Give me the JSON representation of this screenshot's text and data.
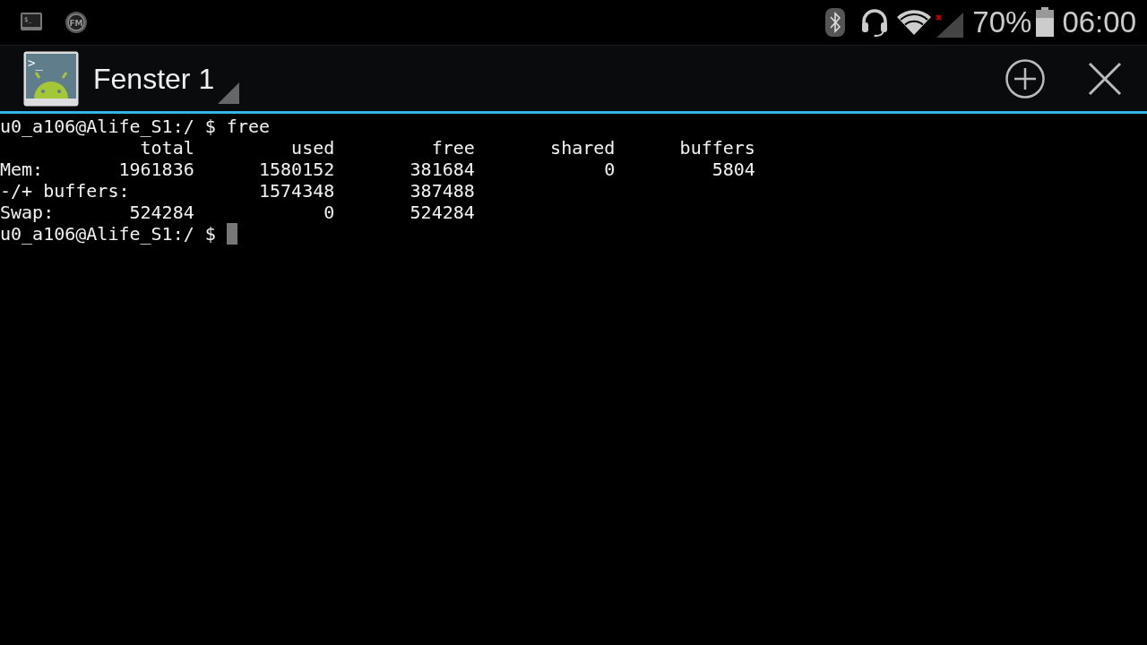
{
  "status_bar": {
    "terminal_icon_text": "$_",
    "radio_icon_text": "FM",
    "battery": "70%",
    "time": "06:00"
  },
  "action_bar": {
    "app_icon_text": ">_",
    "title": "Fenster 1"
  },
  "terminal": {
    "lines": [
      "u0_a106@Alife_S1:/ $ free",
      "             total         used         free       shared      buffers",
      "Mem:       1961836      1580152       381684            0         5804",
      "-/+ buffers:            1574348       387488",
      "Swap:       524284            0       524284",
      "u0_a106@Alife_S1:/ $ "
    ]
  }
}
